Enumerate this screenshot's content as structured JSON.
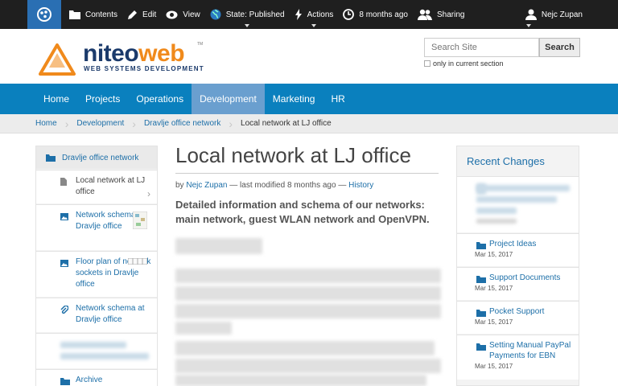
{
  "toolbar": {
    "contents": "Contents",
    "edit": "Edit",
    "view": "View",
    "state": "State: Published",
    "actions": "Actions",
    "time": "8 months ago",
    "sharing": "Sharing",
    "user": "Nejc Zupan"
  },
  "header": {
    "logo_part1": "niteo",
    "logo_part2": "web",
    "logo_sub": "WEB SYSTEMS DEVELOPMENT",
    "logo_tm": "TM",
    "search_placeholder": "Search Site",
    "search_button": "Search",
    "current_section": "only in current section"
  },
  "nav": {
    "items": [
      "Home",
      "Projects",
      "Operations",
      "Development",
      "Marketing",
      "HR"
    ],
    "active": "Development"
  },
  "breadcrumb": {
    "items": [
      "Home",
      "Development",
      "Dravlje office network"
    ],
    "current": "Local network at LJ office"
  },
  "sidebar": {
    "heading": "Dravlje office network",
    "items": [
      {
        "label": "Local network at LJ office"
      },
      {
        "label": "Network schema at Dravlje office"
      },
      {
        "label": "Floor plan of network sockets in Dravlje office"
      },
      {
        "label": "Network schema at Dravlje office"
      },
      {
        "label": "Archive"
      }
    ]
  },
  "main": {
    "title": "Local network at LJ office",
    "by": "by",
    "author": "Nejc Zupan",
    "modified": "— last modified 8 months ago —",
    "history": "History",
    "lead": "Detailed information and schema of our networks: main network, guest WLAN network and OpenVPN."
  },
  "recent": {
    "title": "Recent Changes",
    "items": [
      {
        "label": "Project Ideas",
        "date": "Mar 15, 2017"
      },
      {
        "label": "Support Documents",
        "date": "Mar 15, 2017"
      },
      {
        "label": "Pocket Support",
        "date": "Mar 15, 2017"
      },
      {
        "label": "Setting Manual PayPal Payments for EBN",
        "date": "Mar 15, 2017"
      }
    ]
  },
  "colors": {
    "toolbar": "#1f1f1f",
    "nav": "#0a80be",
    "nav_active": "#6a9fcf",
    "link": "#1d6fa8",
    "brand_orange": "#f08a1c",
    "brand_navy": "#1b3a6b"
  }
}
